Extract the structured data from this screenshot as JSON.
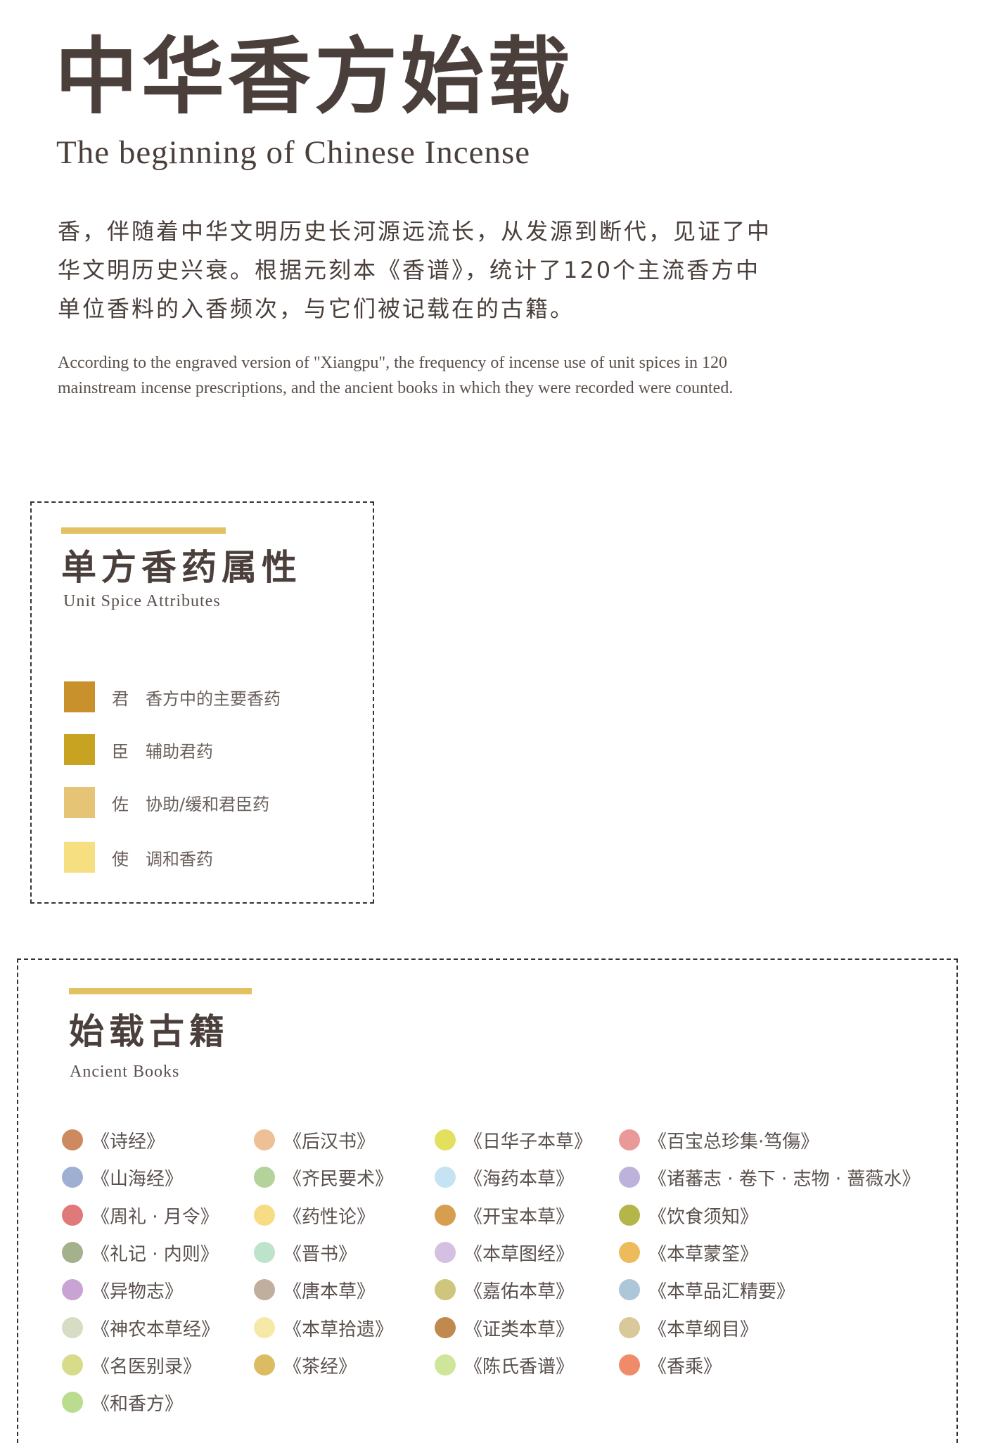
{
  "header": {
    "title_cn": "中华香方始载",
    "title_en": "The beginning of Chinese Incense",
    "intro_cn_lines": [
      "香，伴随着中华文明历史长河源远流长，从发源到断代，见证了中",
      "华文明历史兴衰。根据元刻本《香谱》，统计了120个主流香方中",
      "单位香料的入香频次，与它们被记载在的古籍。"
    ],
    "intro_en_lines": [
      "According to the engraved version of \"Xiangpu\", the frequency of incense use of unit spices in 120",
      "mainstream incense prescriptions, and the ancient books in which they were recorded were counted."
    ]
  },
  "attributes": {
    "title_cn": "单方香药属性",
    "title_en": "Unit Spice Attributes",
    "accent_color": "#e3c163",
    "items": [
      {
        "key": "君",
        "desc": "香方中的主要香药",
        "color": "#c9912b"
      },
      {
        "key": "臣",
        "desc": "辅助君药",
        "color": "#c8a321"
      },
      {
        "key": "佐",
        "desc": "协助/缓和君臣药",
        "color": "#e6c476"
      },
      {
        "key": "使",
        "desc": "调和香药",
        "color": "#f6df80"
      }
    ]
  },
  "books": {
    "title_cn": "始载古籍",
    "title_en": "Ancient Books",
    "accent_color": "#e3c163",
    "columns": [
      [
        {
          "name": "《诗经》",
          "color": "#cc8a5e"
        },
        {
          "name": "《山海经》",
          "color": "#9fafd1"
        },
        {
          "name": "《周礼 · 月令》",
          "color": "#e07a7a"
        },
        {
          "name": "《礼记 · 内则》",
          "color": "#a3b18d"
        },
        {
          "name": "《异物志》",
          "color": "#c9a3d4"
        },
        {
          "name": "《神农本草经》",
          "color": "#d7dcc4"
        },
        {
          "name": "《名医别录》",
          "color": "#d8db8a"
        },
        {
          "name": "《和香方》",
          "color": "#b9dc8f"
        }
      ],
      [
        {
          "name": "《后汉书》",
          "color": "#edc095"
        },
        {
          "name": "《齐民要术》",
          "color": "#b3d39a"
        },
        {
          "name": "《药性论》",
          "color": "#f6dc85"
        },
        {
          "name": "《晋书》",
          "color": "#bde4cb"
        },
        {
          "name": "《唐本草》",
          "color": "#c0ae9f"
        },
        {
          "name": "《本草拾遗》",
          "color": "#f6e9a8"
        },
        {
          "name": "《茶经》",
          "color": "#dcbc63"
        }
      ],
      [
        {
          "name": "《日华子本草》",
          "color": "#e3e060"
        },
        {
          "name": "《海药本草》",
          "color": "#c5e3f3"
        },
        {
          "name": "《开宝本草》",
          "color": "#d89e4f"
        },
        {
          "name": "《本草图经》",
          "color": "#d5c0e2"
        },
        {
          "name": "《嘉佑本草》",
          "color": "#cfc57c"
        },
        {
          "name": "《证类本草》",
          "color": "#c08a4e"
        },
        {
          "name": "《陈氏香谱》",
          "color": "#cfe59a"
        }
      ],
      [
        {
          "name": "《百宝总珍集·笃傷》",
          "color": "#e99a98"
        },
        {
          "name": "《诸蕃志 · 卷下 · 志物 · 蔷薇水》",
          "color": "#bdb3da"
        },
        {
          "name": "《饮食须知》",
          "color": "#b4b64a"
        },
        {
          "name": "《本草蒙筌》",
          "color": "#edbb5c"
        },
        {
          "name": "《本草品汇精要》",
          "color": "#adc6d8"
        },
        {
          "name": "《本草纲目》",
          "color": "#d8c89a"
        },
        {
          "name": "《香乘》",
          "color": "#f08b6a"
        }
      ]
    ]
  }
}
